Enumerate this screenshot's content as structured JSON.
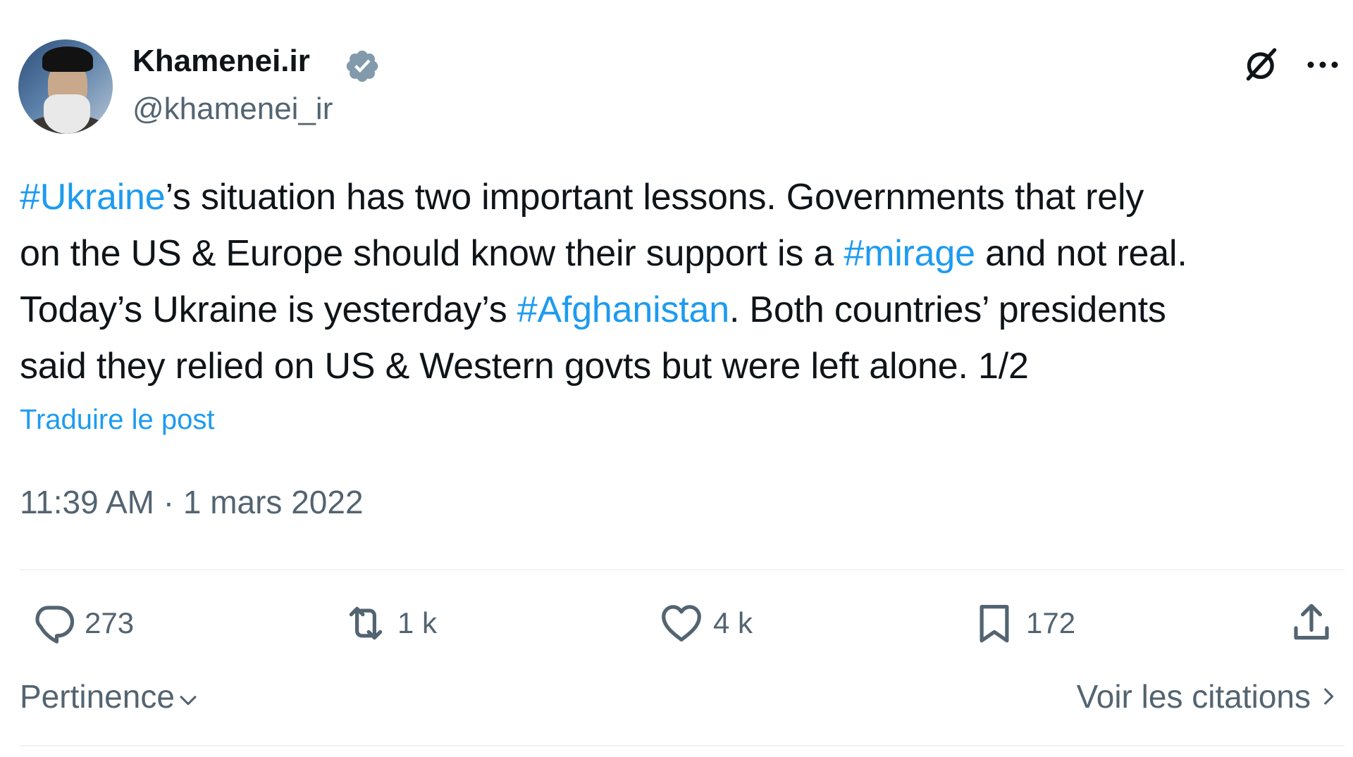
{
  "author": {
    "name": "Khamenei.ir",
    "handle": "@khamenei_ir",
    "verified_color": "#829aab"
  },
  "header": {
    "grok_icon": "grok-icon",
    "more_icon": "more-icon"
  },
  "tweet": {
    "line1": {
      "hashtag": "#Ukraine",
      "text": "’s situation has two important lessons. Governments that rely"
    },
    "line2": {
      "text_before": "on the US & Europe should know their support is a ",
      "hashtag": "#mirage",
      "text_after": " and not real."
    },
    "line3": {
      "text_before": "Today’s Ukraine is yesterday’s ",
      "hashtag": "#Afghanistan",
      "text_after": ". Both countries’ presidents"
    },
    "line4": {
      "text": "said they relied on US & Western govts but were left alone. 1/2"
    },
    "translate_label": "Traduire le post",
    "time": "11:39 AM",
    "separator": " · ",
    "date": "1 mars 2022"
  },
  "actions": {
    "replies": "273",
    "retweets": "1 k",
    "likes": "4 k",
    "bookmarks": "172"
  },
  "footer": {
    "sort_label": "Pertinence",
    "quotes_label": "Voir les citations"
  },
  "colors": {
    "accent": "#1d9bf0",
    "secondary_text": "#536471",
    "primary_text": "#0f1419",
    "divider": "#eff3f4"
  }
}
